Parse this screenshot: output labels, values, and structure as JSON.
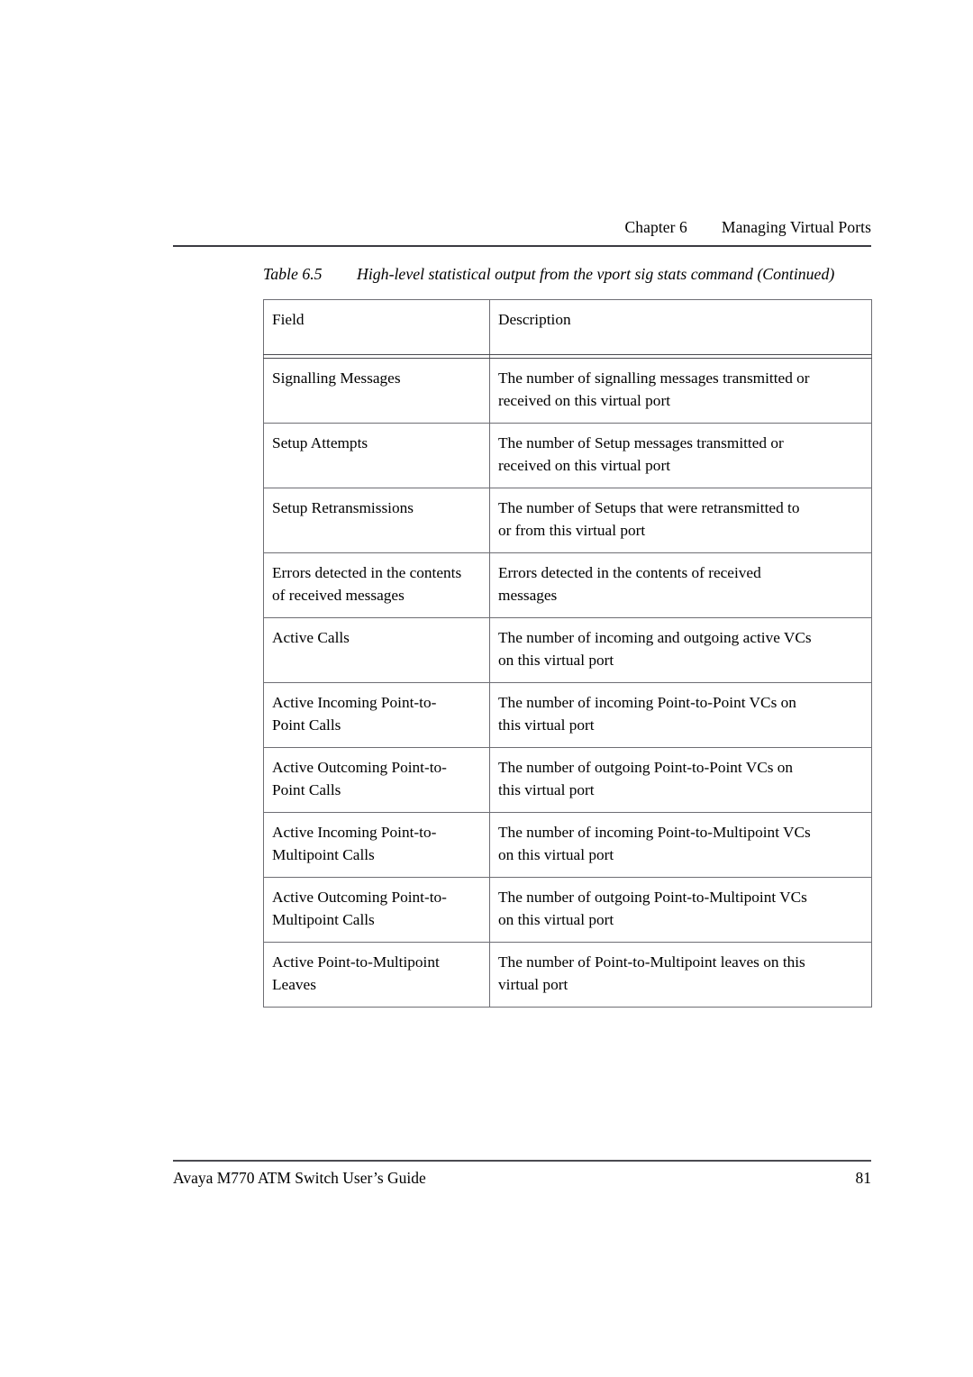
{
  "header": {
    "chapter_label": "Chapter 6",
    "section_title": "Managing Virtual Ports"
  },
  "caption": {
    "number": "Table 6.5",
    "text": "High-level statistical output from the vport sig stats command (Continued)"
  },
  "table": {
    "columns": [
      "Field",
      "Description"
    ],
    "rows": [
      {
        "field": [
          "Signalling Messages"
        ],
        "description": [
          "The number of signalling messages transmitted or",
          "received on this virtual port"
        ]
      },
      {
        "field": [
          "Setup Attempts"
        ],
        "description": [
          "The number of Setup messages transmitted or",
          "received on this virtual port"
        ]
      },
      {
        "field": [
          "Setup Retransmissions"
        ],
        "description": [
          "The number of Setups that were retransmitted to",
          "or from this virtual port"
        ]
      },
      {
        "field": [
          "Errors detected in the contents",
          "of received messages"
        ],
        "description": [
          "Errors detected in the contents of received",
          "messages"
        ]
      },
      {
        "field": [
          "Active Calls"
        ],
        "description": [
          "The number of incoming and outgoing active VCs",
          "on this virtual port"
        ]
      },
      {
        "field": [
          "Active Incoming Point-to-",
          "Point Calls"
        ],
        "description": [
          "The number of incoming Point-to-Point VCs on",
          "this virtual port"
        ]
      },
      {
        "field": [
          "Active Outcoming Point-to-",
          "Point Calls"
        ],
        "description": [
          "The number of outgoing Point-to-Point VCs on",
          "this virtual port"
        ]
      },
      {
        "field": [
          "Active Incoming Point-to-",
          "Multipoint Calls"
        ],
        "description": [
          "The number of incoming Point-to-Multipoint VCs",
          "on this virtual port"
        ]
      },
      {
        "field": [
          "Active Outcoming Point-to-",
          "Multipoint Calls"
        ],
        "description": [
          "The number of outgoing Point-to-Multipoint VCs",
          "on this virtual port"
        ]
      },
      {
        "field": [
          "Active Point-to-Multipoint",
          "Leaves"
        ],
        "description": [
          "The number of Point-to-Multipoint leaves on this",
          "virtual port"
        ]
      }
    ]
  },
  "footer": {
    "guide_title": "Avaya M770 ATM Switch User’s Guide",
    "page_number": "81"
  },
  "colors": {
    "text": "#000000",
    "rule": "#3b3b42",
    "table_border": "#6e6e74",
    "background": "#ffffff"
  }
}
